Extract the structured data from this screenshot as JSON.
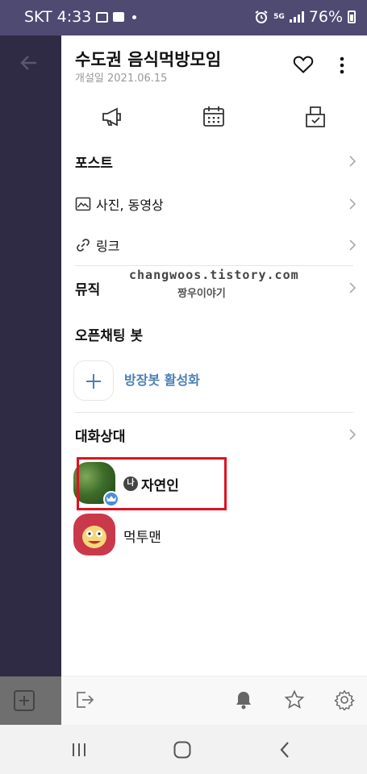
{
  "status_bar": {
    "carrier": "SKT",
    "time": "4:33",
    "network": "5G",
    "battery": "76%"
  },
  "room": {
    "title": "수도권 음식먹방모임",
    "created": "개설일 2021.06.15"
  },
  "menu": {
    "posts": "포스트",
    "photos_videos": "사진, 동영상",
    "links": "링크",
    "music": "뮤직"
  },
  "watermark": {
    "line1": "changwoos.tistory.com",
    "line2": "짱우이야기"
  },
  "openchat_bot": {
    "title": "오픈채팅 봇",
    "activate_label": "방장봇 활성화"
  },
  "members": {
    "title": "대화상대",
    "me_badge": "나",
    "list": [
      {
        "name": "자연인",
        "is_me": true,
        "is_host": true
      },
      {
        "name": "먹투맨",
        "is_me": false,
        "is_host": false
      }
    ]
  },
  "icons": {
    "notice": "megaphone-icon",
    "calendar": "calendar-icon",
    "vote": "vote-box-icon",
    "favorite": "heart-icon",
    "more": "more-vertical-icon",
    "exit": "exit-icon",
    "bell": "bell-icon",
    "star": "star-icon",
    "settings": "gear-icon"
  },
  "colors": {
    "status_bar": "#4e4a72",
    "accent_blue": "#4a7fb5",
    "highlight_red": "#e11020"
  }
}
